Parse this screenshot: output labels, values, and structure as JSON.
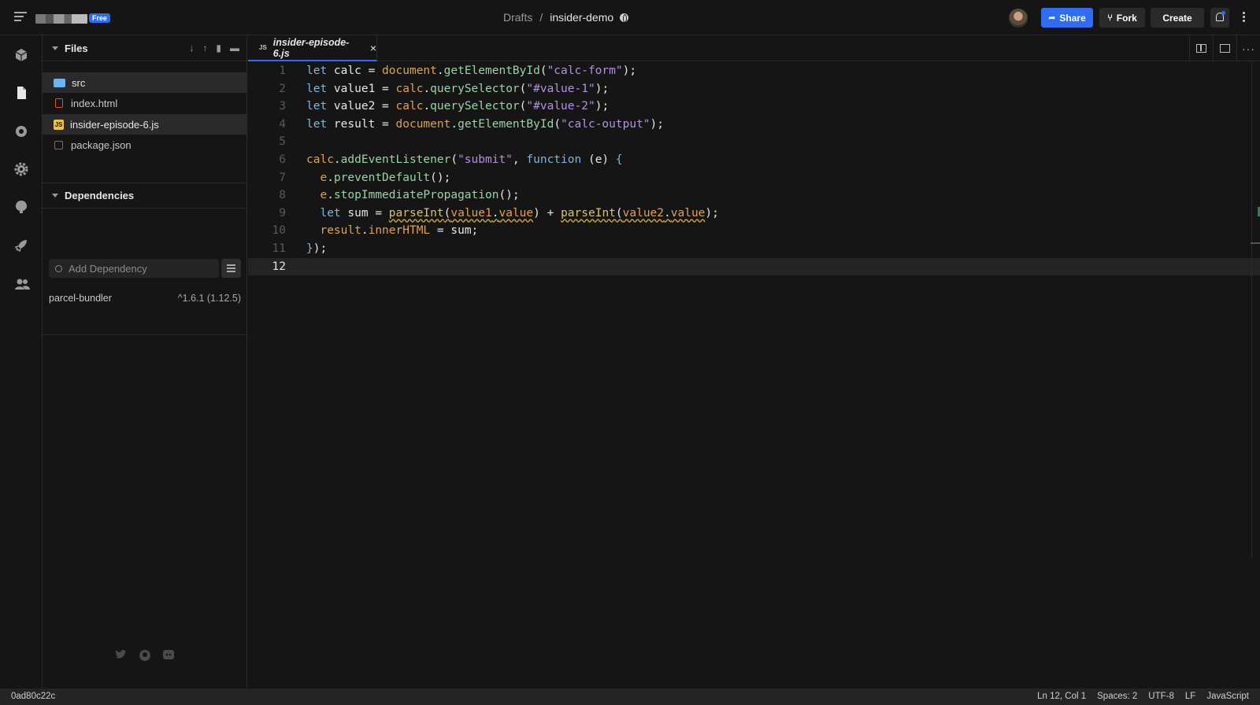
{
  "header": {
    "plan_badge": "Free",
    "breadcrumb": {
      "parent": "Drafts",
      "separator": "/",
      "project": "insider-demo"
    },
    "share_label": "Share",
    "fork_label": "Fork",
    "create_label": "Create"
  },
  "activity_bar": [
    "cube-icon",
    "file-icon",
    "search-icon",
    "gear-icon",
    "github-icon",
    "rocket-icon",
    "users-icon"
  ],
  "files": {
    "title": "Files",
    "items": [
      {
        "name": "src",
        "type": "folder",
        "selected": true
      },
      {
        "name": "index.html",
        "type": "html",
        "selected": false
      },
      {
        "name": "insider-episode-6.js",
        "type": "js",
        "selected": true
      },
      {
        "name": "package.json",
        "type": "json",
        "selected": false
      }
    ]
  },
  "dependencies": {
    "title": "Dependencies",
    "search_placeholder": "Add Dependency",
    "items": [
      {
        "name": "parcel-bundler",
        "version": "^1.6.1 (1.12.5)"
      }
    ]
  },
  "editor": {
    "tab": {
      "badge": "JS",
      "name": "insider-episode-6.js",
      "close": "×"
    },
    "line_numbers": [
      "1",
      "2",
      "3",
      "4",
      "5",
      "6",
      "7",
      "8",
      "9",
      "10",
      "11",
      "12"
    ],
    "current_line": 12
  },
  "status": {
    "commit": "0ad80c22c",
    "position": "Ln 12, Col 1",
    "spaces": "Spaces: 2",
    "encoding": "UTF-8",
    "eol": "LF",
    "language": "JavaScript"
  },
  "colors": {
    "accent": "#2f6cf2",
    "background": "#151515",
    "panel": "#242424"
  }
}
